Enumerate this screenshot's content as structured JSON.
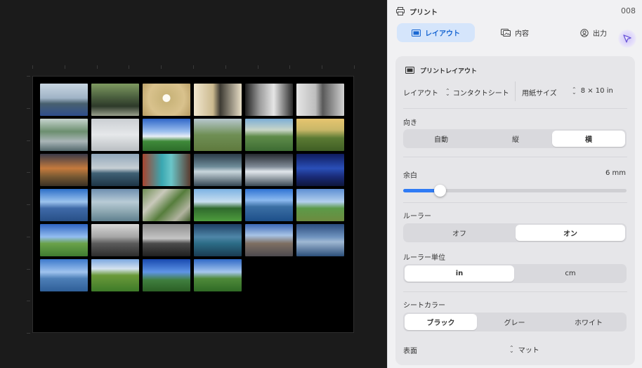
{
  "panel": {
    "title": "プリント",
    "count": "008",
    "tabs": [
      {
        "label": "レイアウト",
        "icon": "layout-icon",
        "active": true
      },
      {
        "label": "内容",
        "icon": "photos-icon",
        "active": false
      },
      {
        "label": "出力",
        "icon": "output-icon",
        "active": false
      }
    ]
  },
  "layout": {
    "section_title": "プリントレイアウト",
    "layout_label": "レイアウト",
    "layout_value": "コンタクトシート",
    "paper_label": "用紙サイズ",
    "paper_value": "8 × 10 in"
  },
  "orientation": {
    "label": "向き",
    "options": [
      "自動",
      "縦",
      "横"
    ],
    "selected": "横"
  },
  "margin": {
    "label": "余白",
    "value": "6 mm",
    "slider_fraction": 0.14
  },
  "ruler": {
    "label": "ルーラー",
    "options": [
      "オフ",
      "オン"
    ],
    "selected": "オン"
  },
  "ruler_unit": {
    "label": "ルーラー単位",
    "options": [
      "in",
      "cm"
    ],
    "selected": "in"
  },
  "sheet_color": {
    "label": "シートカラー",
    "options": [
      "ブラック",
      "グレー",
      "ホワイト"
    ],
    "selected": "ブラック"
  },
  "surface": {
    "label": "表面",
    "value": "マット"
  },
  "colors": {
    "accent": "#2f7bf5",
    "active_tab_bg": "#d5e5fb",
    "active_tab_text": "#1967d2",
    "sheet_background": "#000000"
  },
  "thumbnails": [
    {
      "name": "bridge-sea",
      "g": "linear-gradient(#c9d7e2 0%, #9fb3c6 45%, #48606f 62%, #2f4e8c 100%)"
    },
    {
      "name": "crowd-park",
      "g": "linear-gradient(#7f9a61 0%, #4d6240 40%, #2e3a2a 70%, #9aa08d 100%)"
    },
    {
      "name": "framed-art",
      "g": "radial-gradient(circle at 50% 45%, #fdfbf4 0 12%, #c9b47a 14%, #d9c28d 60%, #b69b62 100%)"
    },
    {
      "name": "gallery-room",
      "g": "linear-gradient(90deg, #f1e7cf 0%, #cbb98f 40%, #3d3a33 55%, #e9dfc7 100%)"
    },
    {
      "name": "gallery-bw",
      "g": "linear-gradient(90deg, #1e1e1e 0%, #9a9a9a 30%, #e6e6e6 60%, #2a2a2a 100%)"
    },
    {
      "name": "towers-bw",
      "g": "linear-gradient(90deg, #e6e6e6 0%, #bdbdbd 40%, #595959 55%, #d3d3d3 100%)"
    },
    {
      "name": "plaza-trees",
      "g": "linear-gradient(#c7d4cf 0%, #6c8f6f 40%, #a9b5b7 70%, #546a6e 100%)"
    },
    {
      "name": "tower-mist",
      "g": "linear-gradient(#cbcfd3 0%, #e6e8ea 50%, #b9bec2 100%)"
    },
    {
      "name": "green-field-sky",
      "g": "linear-gradient(#2f66c9 0%, #9dc0ef 40%, #e8eef6 55%, #3f8a3a 70%, #2d6c2a 100%)"
    },
    {
      "name": "hill-trees",
      "g": "linear-gradient(#b7c7cf 0%, #6f8f55 50%, #5f7a3e 100%)"
    },
    {
      "name": "green-hills",
      "g": "linear-gradient(#7caed6 0%, #c9d6c8 35%, #5f8c4a 55%, #3d6c33 100%)"
    },
    {
      "name": "grass-sunset",
      "g": "linear-gradient(#e7c56f 0%, #c8b768 35%, #5b7a33 60%, #3f5e24 100%)"
    },
    {
      "name": "rocky-sunset",
      "g": "linear-gradient(#3a3a48 0%, #c57a3d 45%, #7a5a33 70%, #3b3024 100%)"
    },
    {
      "name": "sea-dusk",
      "g": "linear-gradient(#91a7bb 0%, #c7cfd4 45%, #3f6074 60%, #1e3546 100%)"
    },
    {
      "name": "pool-resort",
      "g": "linear-gradient(90deg, #a9442f 0%, #3aa7b1 40%, #6ac6c9 60%, #5a3a2e 100%)"
    },
    {
      "name": "sun-water",
      "g": "linear-gradient(#2c3b48 0%, #6e8c99 40%, #c9d6dc 55%, #354754 100%)"
    },
    {
      "name": "silver-sea",
      "g": "linear-gradient(#262a30 0%, #7f8a96 40%, #e1e7ec 55%, #3c4a55 100%)"
    },
    {
      "name": "night-city",
      "g": "linear-gradient(#0f1c5c 0%, #2a4fb8 45%, #1a2c7a 70%, #0e163d 100%)"
    },
    {
      "name": "lake-islands",
      "g": "linear-gradient(#2c6fc8 0%, #9cc3ee 40%, #3f6aa8 60%, #274f87 100%)"
    },
    {
      "name": "frosted-trees",
      "g": "linear-gradient(#6e8fb0 0%, #b8cbd6 40%, #8da7b1 70%, #5e7f8e 100%)"
    },
    {
      "name": "vine-leaves",
      "g": "linear-gradient(135deg, #6f8e54 0%, #c9c9bb 30%, #567d3c 55%, #b1b39f 80%, #415f2c 100%)"
    },
    {
      "name": "trees-lawn",
      "g": "linear-gradient(#7cb2e3 0%, #c8dff0 40%, #2f6a2d 60%, #4e9d3d 100%)"
    },
    {
      "name": "blue-bay",
      "g": "linear-gradient(#2f73d3 0%, #8cbaf0 35%, #3b6fa4 55%, #1d4f8a 100%)"
    },
    {
      "name": "coast-path",
      "g": "linear-gradient(#5d8fd3 0%, #b3d0ee 40%, #5c9a49 60%, #6d8b3f 100%)"
    },
    {
      "name": "fence-pasture",
      "g": "linear-gradient(#2e63c2 0%, #93bdf0 40%, #6aa24a 60%, #3f7c30 100%)"
    },
    {
      "name": "bw-coast",
      "g": "linear-gradient(#d8d8d8 0%, #a5a5a5 40%, #5b5b5b 60%, #2d2d2d 100%)"
    },
    {
      "name": "bw-horizon",
      "g": "linear-gradient(#8e8e8e 0%, #c5c5c5 45%, #4b4b4b 60%, #1f1f1f 100%)"
    },
    {
      "name": "teal-bay",
      "g": "linear-gradient(#1e3f63 0%, #4f86a8 40%, #2c6c86 60%, #1a3c53 100%)"
    },
    {
      "name": "hillside-town",
      "g": "linear-gradient(#3b67b5 0%, #a8c4e6 35%, #7e6f62 60%, #4d4a4f 100%)"
    },
    {
      "name": "evening-sea",
      "g": "linear-gradient(#2a4b7d 0%, #6f93bf 40%, #9fb8d3 55%, #2c4f7a 100%)"
    },
    {
      "name": "calm-lake",
      "g": "linear-gradient(#3c79cc 0%, #9fc3ee 40%, #4d7fb7 60%, #2f5f98 100%)"
    },
    {
      "name": "shadow-field",
      "g": "linear-gradient(#7ba7df 0%, #d6e3ef 30%, #6b9a3a 50%, #3d7a28 100%)"
    },
    {
      "name": "blue-meadow",
      "g": "linear-gradient(#1849b0 0%, #5f95e6 40%, #3f7e3e 65%, #2b5f25 100%)"
    },
    {
      "name": "lone-tree",
      "g": "linear-gradient(#2f69c7 0%, #a6c7ee 40%, #4f8a3a 60%, #2f6a25 100%)"
    }
  ]
}
